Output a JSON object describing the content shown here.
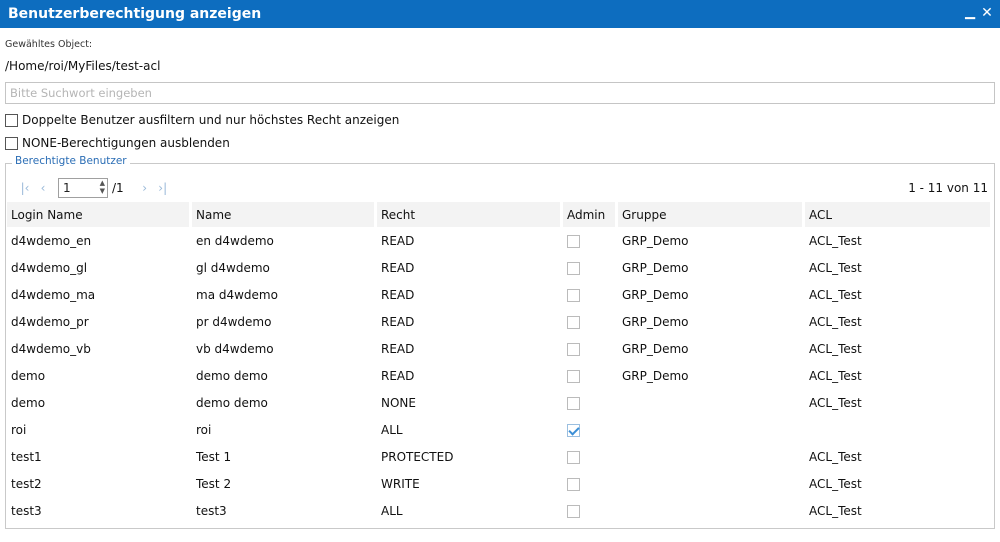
{
  "window": {
    "title": "Benutzerberechtigung anzeigen",
    "minimize_icon": "minimize-icon",
    "close_icon": "close-icon"
  },
  "object": {
    "label": "Gewähltes Object:",
    "path": "/Home/roi/MyFiles/test-acl"
  },
  "search": {
    "placeholder": "Bitte Suchwort eingeben",
    "value": ""
  },
  "options": [
    {
      "label": "Doppelte Benutzer ausfiltern und nur höchstes Recht anzeigen",
      "checked": false
    },
    {
      "label": "NONE-Berechtigungen ausblenden",
      "checked": false
    }
  ],
  "group": {
    "legend": "Berechtigte Benutzer"
  },
  "pager": {
    "page": "1",
    "total": "/1",
    "summary": "1 - 11 von 11",
    "first_icon": "first-page-icon",
    "prev_icon": "prev-page-icon",
    "next_icon": "next-page-icon",
    "last_icon": "last-page-icon"
  },
  "table": {
    "columns": [
      "Login Name",
      "Name",
      "Recht",
      "Admin",
      "Gruppe",
      "ACL"
    ],
    "rows": [
      {
        "login": "d4wdemo_en",
        "name": "en d4wdemo",
        "recht": "READ",
        "admin": false,
        "gruppe": "GRP_Demo",
        "acl": "ACL_Test"
      },
      {
        "login": "d4wdemo_gl",
        "name": "gl d4wdemo",
        "recht": "READ",
        "admin": false,
        "gruppe": "GRP_Demo",
        "acl": "ACL_Test"
      },
      {
        "login": "d4wdemo_ma",
        "name": "ma d4wdemo",
        "recht": "READ",
        "admin": false,
        "gruppe": "GRP_Demo",
        "acl": "ACL_Test"
      },
      {
        "login": "d4wdemo_pr",
        "name": "pr d4wdemo",
        "recht": "READ",
        "admin": false,
        "gruppe": "GRP_Demo",
        "acl": "ACL_Test"
      },
      {
        "login": "d4wdemo_vb",
        "name": "vb d4wdemo",
        "recht": "READ",
        "admin": false,
        "gruppe": "GRP_Demo",
        "acl": "ACL_Test"
      },
      {
        "login": "demo",
        "name": "demo demo",
        "recht": "READ",
        "admin": false,
        "gruppe": "GRP_Demo",
        "acl": "ACL_Test"
      },
      {
        "login": "demo",
        "name": "demo demo",
        "recht": "NONE",
        "admin": false,
        "gruppe": "",
        "acl": "ACL_Test"
      },
      {
        "login": "roi",
        "name": "roi",
        "recht": "ALL",
        "admin": true,
        "gruppe": "",
        "acl": ""
      },
      {
        "login": "test1",
        "name": "Test 1",
        "recht": "PROTECTED",
        "admin": false,
        "gruppe": "",
        "acl": "ACL_Test"
      },
      {
        "login": "test2",
        "name": "Test 2",
        "recht": "WRITE",
        "admin": false,
        "gruppe": "",
        "acl": "ACL_Test"
      },
      {
        "login": "test3",
        "name": "test3",
        "recht": "ALL",
        "admin": false,
        "gruppe": "",
        "acl": "ACL_Test"
      }
    ]
  }
}
